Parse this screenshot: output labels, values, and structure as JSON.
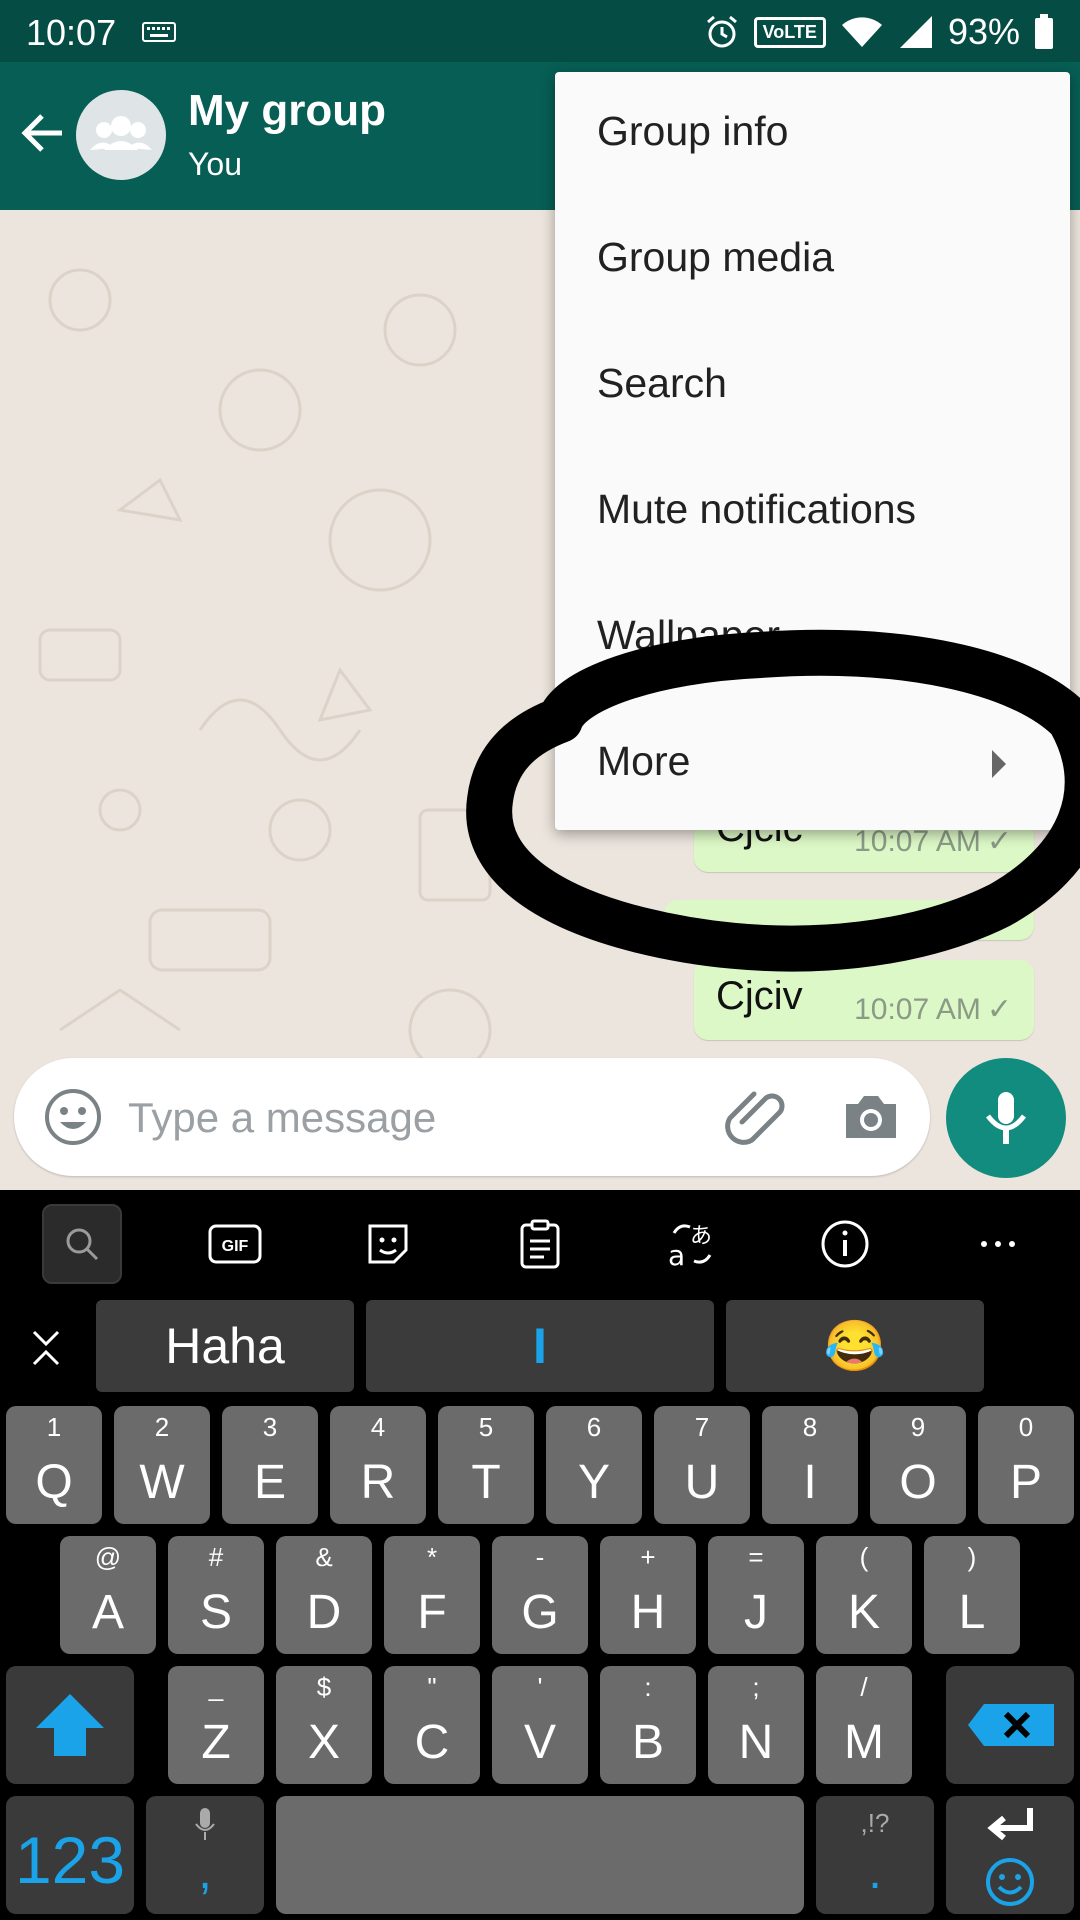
{
  "status_bar": {
    "time": "10:07",
    "network_badge": "VoLTE",
    "battery_percent": "93%"
  },
  "app_bar": {
    "title": "My group",
    "subtitle": "You"
  },
  "menu": {
    "items": [
      {
        "label": "Group info"
      },
      {
        "label": "Group media"
      },
      {
        "label": "Search"
      },
      {
        "label": "Mute notifications"
      },
      {
        "label": "Wallpaper"
      },
      {
        "label": "More"
      }
    ]
  },
  "messages": [
    {
      "text": "Cjcic",
      "time": "10:07 AM"
    },
    {
      "text": "Cjciv",
      "time": "10:07 AM"
    }
  ],
  "input": {
    "placeholder": "Type a message"
  },
  "keyboard": {
    "suggestions": [
      "Haha",
      "I",
      "😂"
    ],
    "row1": [
      {
        "main": "Q",
        "alt": "1"
      },
      {
        "main": "W",
        "alt": "2"
      },
      {
        "main": "E",
        "alt": "3"
      },
      {
        "main": "R",
        "alt": "4"
      },
      {
        "main": "T",
        "alt": "5"
      },
      {
        "main": "Y",
        "alt": "6"
      },
      {
        "main": "U",
        "alt": "7"
      },
      {
        "main": "I",
        "alt": "8"
      },
      {
        "main": "O",
        "alt": "9"
      },
      {
        "main": "P",
        "alt": "0"
      }
    ],
    "row2": [
      {
        "main": "A",
        "alt": "@"
      },
      {
        "main": "S",
        "alt": "#"
      },
      {
        "main": "D",
        "alt": "&"
      },
      {
        "main": "F",
        "alt": "*"
      },
      {
        "main": "G",
        "alt": "-"
      },
      {
        "main": "H",
        "alt": "+"
      },
      {
        "main": "J",
        "alt": "="
      },
      {
        "main": "K",
        "alt": "("
      },
      {
        "main": "L",
        "alt": ")"
      }
    ],
    "row3": [
      {
        "main": "Z",
        "alt": "_"
      },
      {
        "main": "X",
        "alt": "$"
      },
      {
        "main": "C",
        "alt": "\""
      },
      {
        "main": "V",
        "alt": "'"
      },
      {
        "main": "B",
        "alt": ":"
      },
      {
        "main": "N",
        "alt": ";"
      },
      {
        "main": "M",
        "alt": "/"
      }
    ],
    "numbers_label": "123",
    "comma_label": ",",
    "period_label": ".",
    "punct_alt": ",!?"
  },
  "colors": {
    "status_bar": "#054d44",
    "app_bar": "#075e54",
    "accent": "#128c7e",
    "bubble": "#dcf8c6",
    "keyboard_accent": "#1aa3e8"
  }
}
